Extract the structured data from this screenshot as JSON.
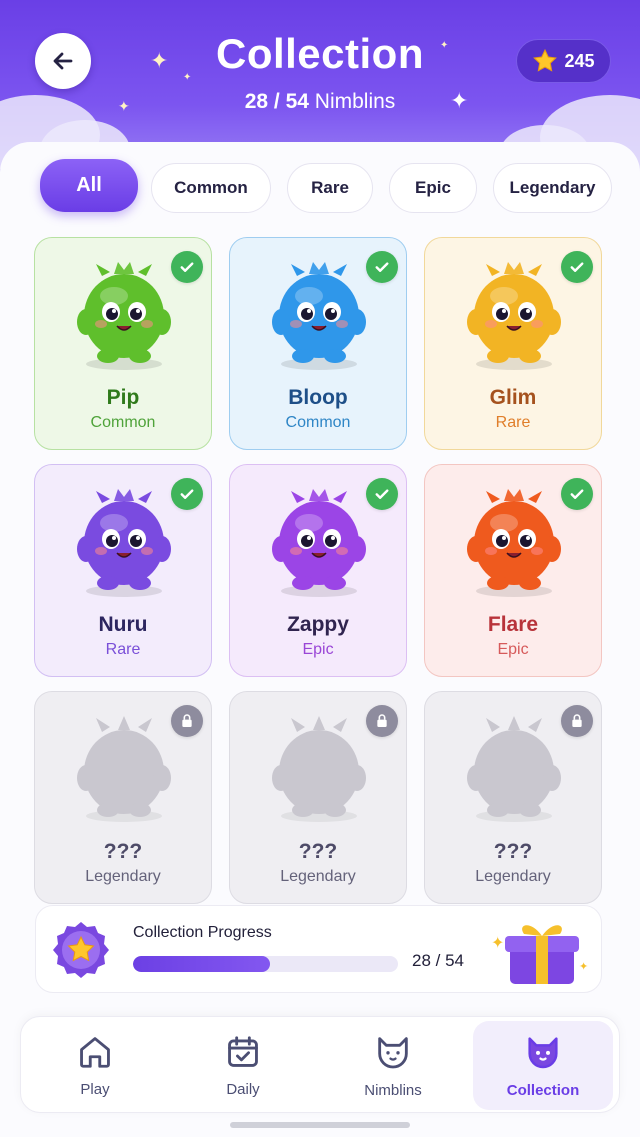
{
  "header": {
    "title": "Collection",
    "count_owned": "28 / 54",
    "count_suffix": "Nimblins",
    "coins": "245",
    "accent": "#6a3fe6"
  },
  "filters": [
    {
      "label": "All",
      "active": true
    },
    {
      "label": "Common",
      "active": false
    },
    {
      "label": "Rare",
      "active": false
    },
    {
      "label": "Epic",
      "active": false
    },
    {
      "label": "Legendary",
      "active": false
    }
  ],
  "creatures": [
    {
      "name": "Pip",
      "rarity": "Common",
      "status": "collected",
      "body": "#5fbf2c",
      "name_color": "#2f7a1b",
      "rarity_color": "#4fa33a",
      "bg": "#eef8e7",
      "border": "#b7e1a2"
    },
    {
      "name": "Bloop",
      "rarity": "Common",
      "status": "collected",
      "body": "#2f97ea",
      "name_color": "#1e4f88",
      "rarity_color": "#2f86c6",
      "bg": "#e7f3fc",
      "border": "#9fcdf0"
    },
    {
      "name": "Glim",
      "rarity": "Rare",
      "status": "collected",
      "body": "#f2b424",
      "name_color": "#a5521e",
      "rarity_color": "#e07e2a",
      "bg": "#fdf5e4",
      "border": "#f1d89a"
    },
    {
      "name": "Nuru",
      "rarity": "Rare",
      "status": "collected",
      "body": "#7a4be0",
      "name_color": "#2d2660",
      "rarity_color": "#7a4fd8",
      "bg": "#f3ecfc",
      "border": "#d2bff3"
    },
    {
      "name": "Zappy",
      "rarity": "Epic",
      "status": "collected",
      "body": "#9b45e6",
      "name_color": "#30244f",
      "rarity_color": "#9a46d6",
      "bg": "#f5eafc",
      "border": "#dcbff3"
    },
    {
      "name": "Flare",
      "rarity": "Epic",
      "status": "collected",
      "body": "#ef5a1e",
      "name_color": "#b8333a",
      "rarity_color": "#d65a5a",
      "bg": "#fdeceb",
      "border": "#f3c6c2"
    },
    {
      "name": "???",
      "rarity": "Legendary",
      "status": "locked",
      "body": "#c9c7cf",
      "name_color": "#4e4b68",
      "rarity_color": "#64627a",
      "bg": "#efeef2",
      "border": "#dddce3"
    },
    {
      "name": "???",
      "rarity": "Legendary",
      "status": "locked",
      "body": "#c9c7cf",
      "name_color": "#4e4b68",
      "rarity_color": "#64627a",
      "bg": "#efeef2",
      "border": "#dddce3"
    },
    {
      "name": "???",
      "rarity": "Legendary",
      "status": "locked",
      "body": "#c9c7cf",
      "name_color": "#4e4b68",
      "rarity_color": "#64627a",
      "bg": "#efeef2",
      "border": "#dddce3"
    }
  ],
  "progress": {
    "label": "Collection Progress",
    "count": "28 / 54",
    "fraction": 0.5185,
    "icons": [
      "star-badge-icon",
      "gift-box-icon"
    ]
  },
  "nav": [
    {
      "label": "Play",
      "icon": "home-icon",
      "active": false
    },
    {
      "label": "Daily",
      "icon": "calendar-check-icon",
      "active": false
    },
    {
      "label": "Nimblins",
      "icon": "cat-face-icon",
      "active": false
    },
    {
      "label": "Collection",
      "icon": "cat-face-filled-icon",
      "active": true
    }
  ]
}
